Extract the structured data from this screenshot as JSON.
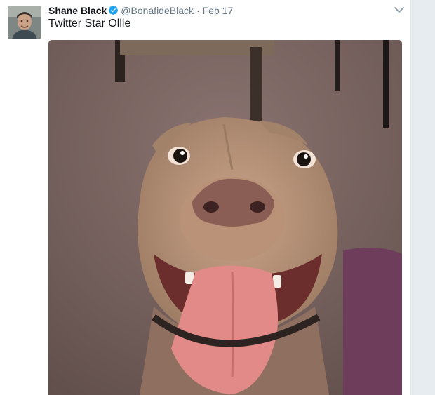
{
  "tweet": {
    "author": {
      "display_name": "Shane Black",
      "screen_name": "@BonafideBlack",
      "verified": true,
      "verified_icon": "verified-badge-icon"
    },
    "separator": "·",
    "timestamp": "Feb 17",
    "text": "Twitter Star Ollie",
    "menu_icon": "chevron-down-icon",
    "media": {
      "type": "photo"
    }
  },
  "colors": {
    "name": "#14171a",
    "secondary": "#657786",
    "verified": "#1da1f2",
    "background": "#e6ecf0"
  }
}
